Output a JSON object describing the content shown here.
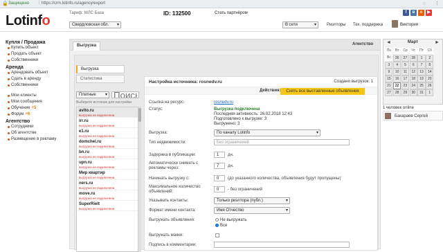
{
  "browser": {
    "secure": "Защищено",
    "url": "https://crm.lotinfo.ru/agency/export"
  },
  "header": {
    "logo_a": "Lotinf",
    "logo_b": "o",
    "tariff": "Тариф: МЛС База",
    "region": "Свердловская обл.",
    "id": "ID: 132500",
    "partner": "Стать партнёром",
    "network": "В сети",
    "rieltors": "Риэлторы",
    "tech": "Тех. поддержка",
    "user": "Виктория"
  },
  "sidebar": {
    "sections": [
      {
        "title": "Купля / Продажа",
        "items": [
          "Купить объект",
          "Продать объект",
          "Собственники"
        ]
      },
      {
        "title": "Аренда",
        "items": [
          "Арендовать объект",
          "Сдать в аренду",
          "Собственники"
        ]
      },
      {
        "title": "",
        "items": [
          "Мои клиенты",
          "Мои сообщения",
          "Обучение",
          "Форум"
        ],
        "badges": {
          "Обучение": "+5",
          "Форум": "+6"
        }
      },
      {
        "title": "Агентство",
        "items": [
          "Сотрудники",
          "Об агентстве",
          "Размещение в рекламу"
        ]
      }
    ]
  },
  "main": {
    "tab": "Выгрузка",
    "agency": "Агентство",
    "subtabs": [
      "Выгрузка",
      "Статистика"
    ],
    "filter": "Платные",
    "search_placeholder": "Поиск",
    "hint": "Выберите источник для настройки",
    "sources": [
      {
        "name": "avito.ru",
        "status": "выгрузка не подключена"
      },
      {
        "name": "irr.ru",
        "status": "выгрузка не подключена"
      },
      {
        "name": "e1.ru",
        "status": "выгрузка не подключена"
      },
      {
        "name": "domchel.ru",
        "status": "выгрузка не подключена"
      },
      {
        "name": "bn.ru",
        "status": "выгрузка не подключена"
      },
      {
        "name": "upn.ru",
        "status": "выгрузка не подключена"
      },
      {
        "name": "Мир квартир",
        "status": "выгрузка не подключена"
      },
      {
        "name": "ners.ru",
        "status": "выгрузка не подключена"
      },
      {
        "name": "move.ru",
        "status": "выгрузка не подключена"
      },
      {
        "name": "SuperRielt",
        "status": "выгрузка не подключена"
      }
    ]
  },
  "settings": {
    "title": "Настройка источника: rosnedv.ru",
    "created": "Создано выгрузок: 1",
    "actions_label": "Действия:",
    "actions_button": "Снять все выставленные объявления",
    "link_label": "Ссылка на ресурс:",
    "link_value": "rosnedv.ru",
    "status_label": "Статус:",
    "status_value": "Выгрузка подключена",
    "status_lines": [
      "Последняя активность: 26.02.2018 12:43",
      "Подготовлено к выгрузке: 3",
      "Выгружено: 3"
    ],
    "export_label": "Выгрузка:",
    "export_value": "По каналу Lotinfo",
    "type_label": "Тип недвижимости:",
    "type_placeholder": "Без ограничений",
    "delay_label": "Задержка в публикации:",
    "delay_value": "1",
    "delay_unit": "дн.",
    "auto_label": "Автоматически снимать с рекламы через:",
    "auto_value": "7",
    "auto_unit": "дн.",
    "start_label": "Начинать выгрузку с:",
    "start_value": "0",
    "start_note": "(до указанного количества, объявления будут пропущены)",
    "max_label": "Максимальное количество объявлений:",
    "max_value": "0",
    "max_note": "- без ограничений",
    "contacts_label": "Указывать контакты:",
    "contacts_value": "Только риэлтора (публ.)",
    "format_label": "Формат имени контакта:",
    "format_value": "Имя Отчество",
    "upload_label": "Выгружать объявления:",
    "radio_a": "Не выгружать",
    "radio_b": "Все",
    "lighthouse_label": "Выгружать маяки:",
    "comment_label": "Подпись в комментарии:"
  },
  "calendar": {
    "month": "Март",
    "prev": "◄",
    "next": "►",
    "weekdays": [
      "Пн",
      "Вт",
      "Ср",
      "Чт",
      "Пт",
      "Сб",
      "Вс"
    ],
    "days": [
      "26",
      "27",
      "28",
      "1",
      "2",
      "3",
      "4",
      "5",
      "6",
      "7",
      "8",
      "9",
      "10",
      "11",
      "12",
      "13",
      "14",
      "15",
      "16",
      "17",
      "18",
      "19",
      "20",
      "21",
      "22",
      "23",
      "24",
      "25",
      "26",
      "27",
      "28",
      "29",
      "30",
      "31",
      "1"
    ]
  },
  "online": {
    "label": "1 человек online",
    "user": "Бакараев Сергей"
  }
}
